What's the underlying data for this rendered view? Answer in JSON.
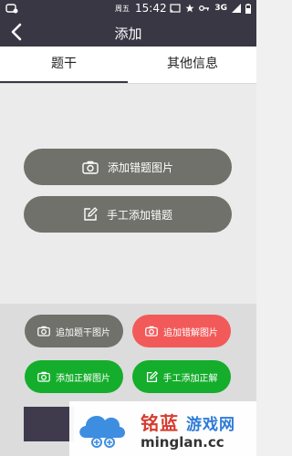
{
  "status": {
    "day": "周五",
    "time": "15:42",
    "network": "3G"
  },
  "nav": {
    "title": "添加"
  },
  "tabs": [
    {
      "label": "题干",
      "active": true
    },
    {
      "label": "其他信息",
      "active": false
    }
  ],
  "main": {
    "add_question_image": "添加错题图片",
    "manual_add_question": "手工添加错题"
  },
  "bottom": {
    "add_stem_image": "追加题干图片",
    "add_wrong_answer_image": "追加错解图片",
    "add_correct_answer_image": "添加正解图片",
    "manual_add_correct_answer": "手工添加正解"
  },
  "watermark": {
    "brand": "铭蓝",
    "games": "游戏网",
    "site": "minglan.cc"
  },
  "colors": {
    "header": "#3a3744",
    "gray_button": "#6f716a",
    "red_button": "#f25a5a",
    "green_button": "#15ad2c"
  }
}
